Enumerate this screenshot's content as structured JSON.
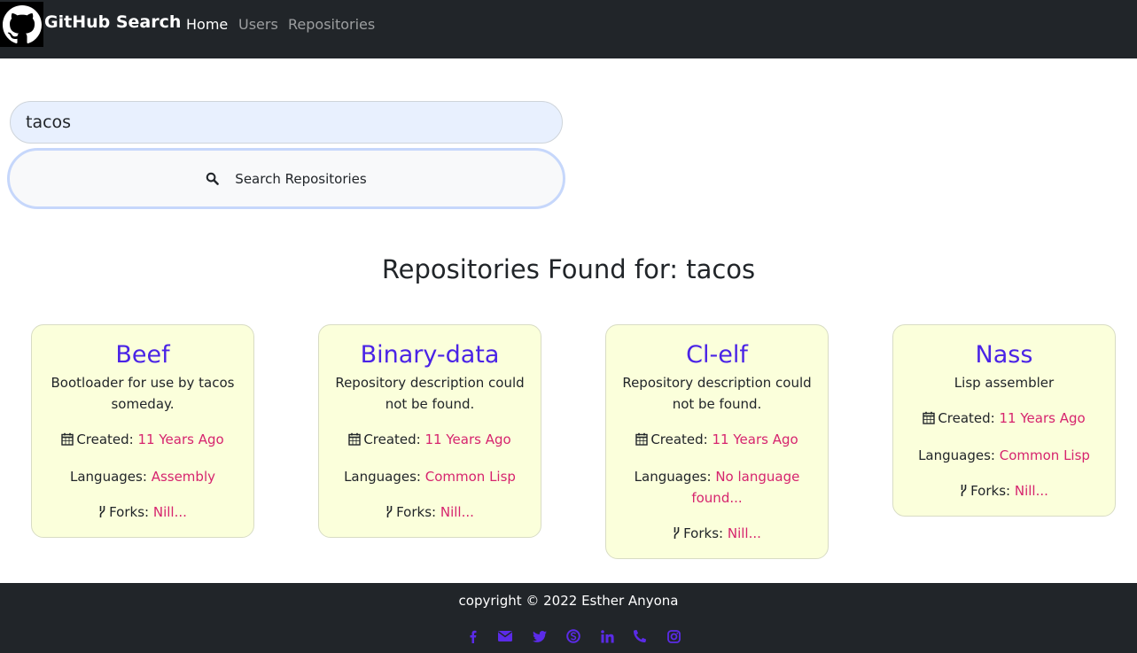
{
  "navbar": {
    "brand": "GitHub Search",
    "links": [
      "Home",
      "Users",
      "Repositories"
    ]
  },
  "search": {
    "value": "tacos",
    "button_label": "Search Repositories"
  },
  "results": {
    "heading": "Repositories Found for: tacos",
    "cards": [
      {
        "name": "Beef",
        "description": "Bootloader for use by tacos someday.",
        "created_label": "Created:",
        "created_value": "11 Years Ago",
        "languages_label": "Languages:",
        "languages_value": "Assembly",
        "forks_label": "Forks:",
        "forks_value": "Nill..."
      },
      {
        "name": "Binary-data",
        "description": "Repository description could not be found.",
        "created_label": "Created:",
        "created_value": "11 Years Ago",
        "languages_label": "Languages:",
        "languages_value": "Common Lisp",
        "forks_label": "Forks:",
        "forks_value": "Nill..."
      },
      {
        "name": "Cl-elf",
        "description": "Repository description could not be found.",
        "created_label": "Created:",
        "created_value": "11 Years Ago",
        "languages_label": "Languages:",
        "languages_value": "No language found...",
        "forks_label": "Forks:",
        "forks_value": "Nill..."
      },
      {
        "name": "Nass",
        "description": "Lisp assembler",
        "created_label": "Created:",
        "created_value": "11 Years Ago",
        "languages_label": "Languages:",
        "languages_value": "Common Lisp",
        "forks_label": "Forks:",
        "forks_value": "Nill..."
      }
    ]
  },
  "footer": {
    "copyright": "copyright © 2022 Esther Anyona",
    "social_icons": [
      "facebook-icon",
      "envelope-icon",
      "twitter-icon",
      "skype-icon",
      "linkedin-icon",
      "phone-icon",
      "instagram-icon"
    ]
  },
  "colors": {
    "navbar_bg": "#212529",
    "card_bg": "#fbffdb",
    "title_color": "#4a23e6",
    "accent": "#d6246e",
    "social_icon": "#5b2be8"
  }
}
